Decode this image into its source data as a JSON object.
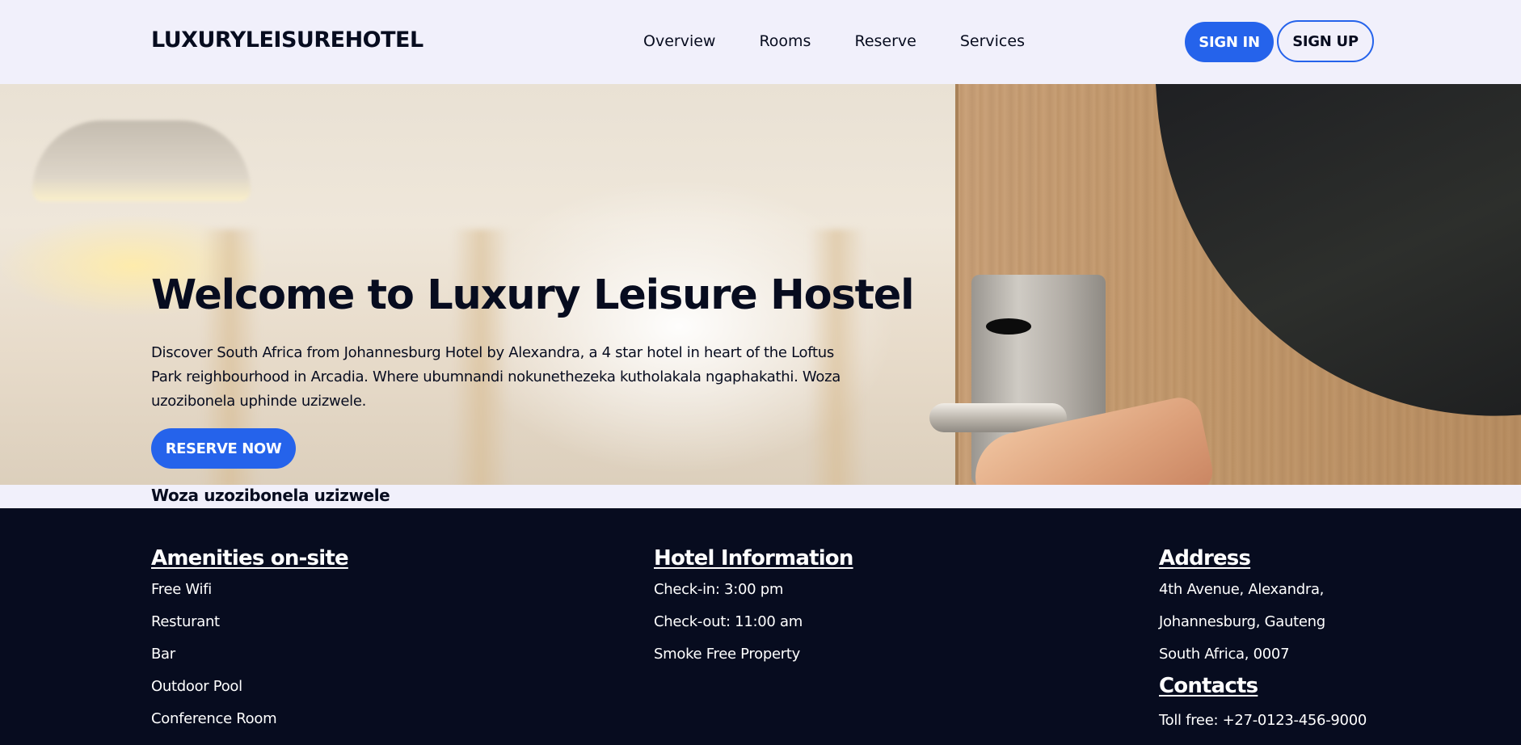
{
  "header": {
    "logo": "LUXURYLEISUREHOTEL",
    "nav": [
      "Overview",
      "Rooms",
      "Reserve",
      "Services"
    ],
    "sign_in": "SIGN IN",
    "sign_up": "SIGN UP"
  },
  "hero": {
    "title": "Welcome to Luxury Leisure Hostel",
    "description": "Discover South Africa from Johannesburg Hotel by Alexandra, a 4 star hotel in heart of the Loftus Park reighbourhood in Arcadia. Where ubumnandi nokunethezeka kutholakala ngaphakathi. Woza uzozibonela uphinde uzizwele.",
    "cta": "RESERVE NOW"
  },
  "tagline": "Woza uzozibonela uzizwele",
  "footer": {
    "amenities": {
      "heading": "Amenities on-site",
      "items": [
        "Free Wifi",
        "Resturant",
        "Bar",
        "Outdoor Pool",
        "Conference Room"
      ]
    },
    "hotel_info": {
      "heading": "Hotel Information",
      "items": [
        "Check-in: 3:00 pm",
        "Check-out: 11:00 am",
        "Smoke Free Property"
      ]
    },
    "address": {
      "heading": "Address",
      "lines": [
        "4th Avenue, Alexandra,",
        "Johannesburg, Gauteng",
        "South Africa, 0007"
      ]
    },
    "contacts": {
      "heading": "Contacts",
      "lines": [
        "Toll free: +27-0123-456-9000"
      ]
    }
  },
  "colors": {
    "accent": "#2563eb",
    "dark": "#070c1f",
    "background": "#f1f0fb"
  }
}
